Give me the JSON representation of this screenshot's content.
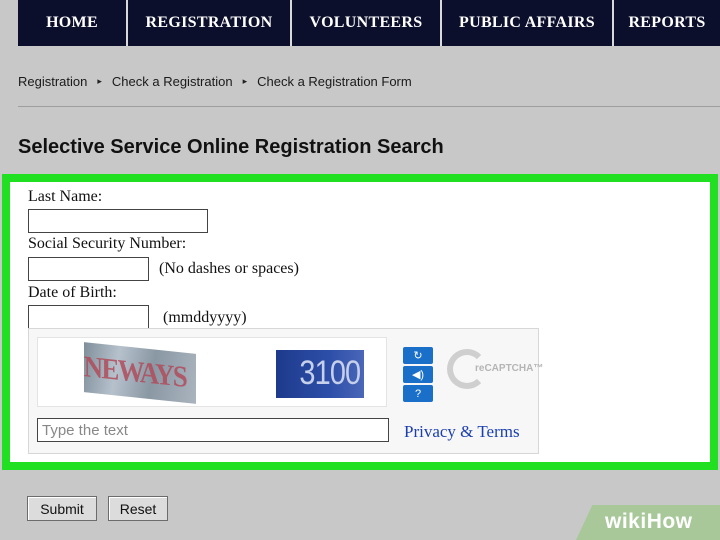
{
  "nav": {
    "items": [
      {
        "label": "HOME"
      },
      {
        "label": "REGISTRATION"
      },
      {
        "label": "VOLUNTEERS"
      },
      {
        "label": "PUBLIC AFFAIRS"
      },
      {
        "label": "REPORTS"
      }
    ]
  },
  "breadcrumb": {
    "items": [
      "Registration",
      "Check a Registration",
      "Check a Registration Form"
    ],
    "separator": "▸"
  },
  "page": {
    "title": "Selective Service Online Registration Search"
  },
  "form": {
    "last_name": {
      "label": "Last Name:",
      "value": ""
    },
    "ssn": {
      "label": "Social Security Number:",
      "value": "",
      "hint": "(No dashes or spaces)"
    },
    "dob": {
      "label": "Date of Birth:",
      "value": "",
      "hint": "(mmddyyyy)"
    }
  },
  "captcha": {
    "words": [
      "NEWAYS",
      "3100"
    ],
    "input_placeholder": "Type the text",
    "input_value": "",
    "privacy_link": "Privacy & Terms",
    "logo_text": "reCAPTCHA™",
    "icons": [
      "refresh-icon",
      "audio-icon",
      "help-icon"
    ]
  },
  "buttons": {
    "submit": "Submit",
    "reset": "Reset"
  },
  "watermark": {
    "prefix": "wiki",
    "suffix": "How"
  },
  "colors": {
    "nav_background": "#0b0f2c",
    "highlight_border": "#21e021",
    "link": "#1a3fb0",
    "captcha_button": "#1a6fc9"
  }
}
